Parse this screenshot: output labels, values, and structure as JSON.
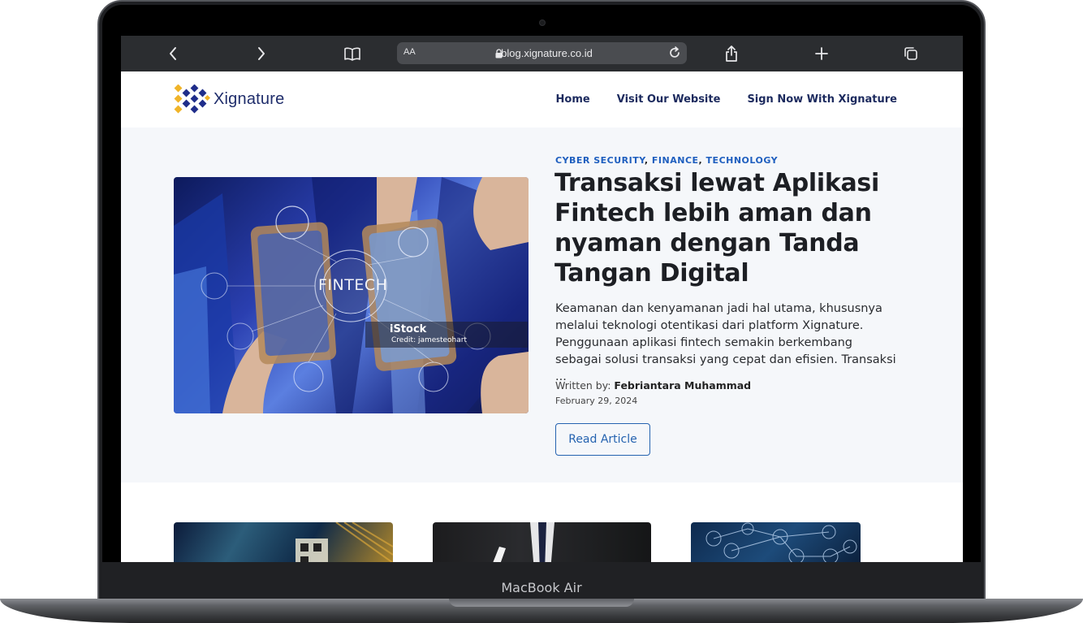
{
  "device": {
    "model_label": "MacBook Air"
  },
  "browser": {
    "text_size_label": "AA",
    "url": "blog.xignature.co.id"
  },
  "site": {
    "logo_text": "Xignature",
    "nav": [
      "Home",
      "Visit Our Website",
      "Sign Now With Xignature"
    ]
  },
  "hero": {
    "image_caption": {
      "headline": "FINTECH",
      "stock": "iStock",
      "credit": "Credit: jamesteohart"
    },
    "categories": [
      "CYBER SECURITY",
      "FINANCE",
      "TECHNOLOGY"
    ],
    "title": "Transaksi lewat Aplikasi Fintech lebih aman dan nyaman dengan Tanda Tangan Digital",
    "excerpt": "Keamanan dan kenyamanan jadi hal utama, khususnya melalui teknologi otentikasi dari platform Xignature. Penggunaan aplikasi fintech semakin berkembang sebagai solusi transaksi yang cepat dan efisien. Transaksi ...",
    "written_by_label": "Written by:",
    "author": "Febriantara Muhammad",
    "date": "February 29, 2024",
    "cta": "Read Article"
  },
  "colors": {
    "accent": "#2563b0",
    "nav_text": "#1c2a5e",
    "toolbar": "#2b2d30",
    "hero_bg": "#f5f7fa"
  }
}
